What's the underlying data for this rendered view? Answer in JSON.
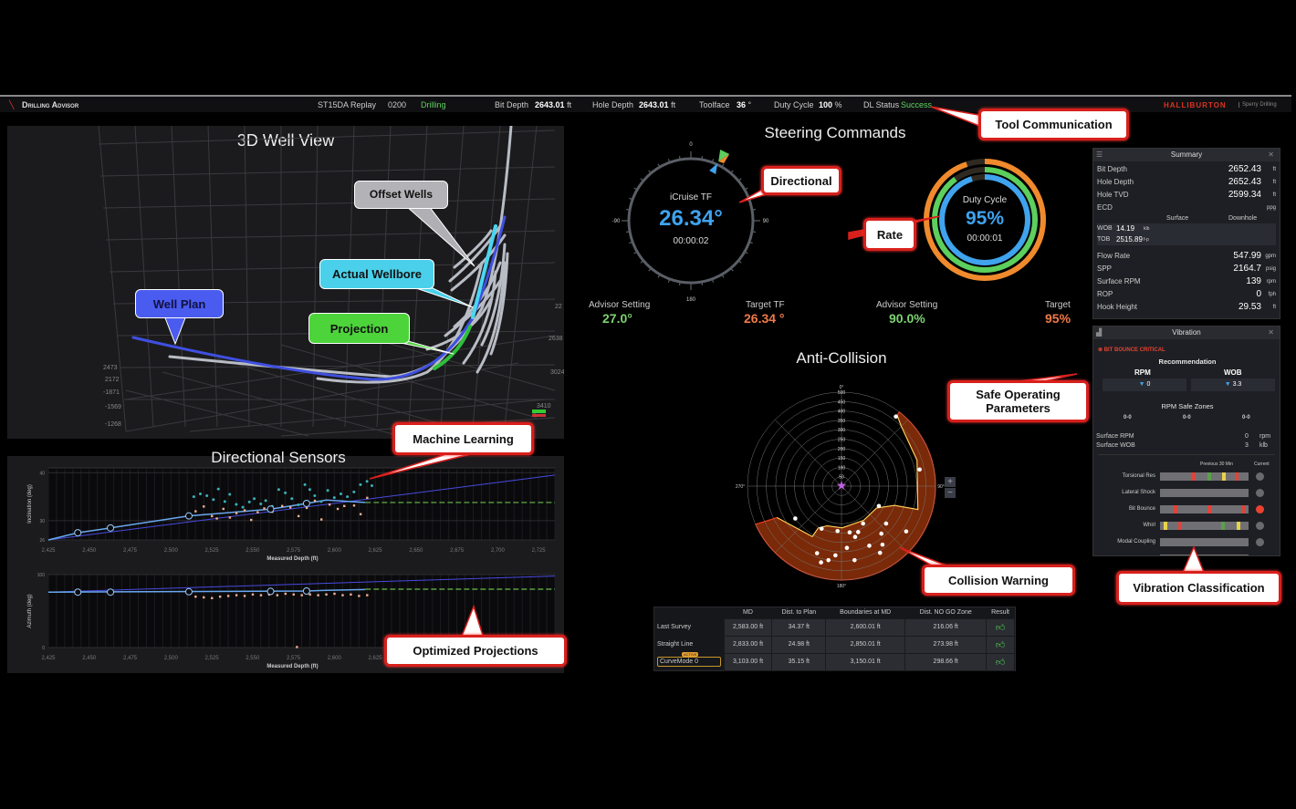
{
  "topbar": {
    "app_title": "Drilling Advisor",
    "well": "ST15DA Replay",
    "run": "0200",
    "state": "Drilling",
    "bit_depth_label": "Bit Depth",
    "bit_depth": "2643.01",
    "bit_depth_unit": "ft",
    "hole_depth_label": "Hole Depth",
    "hole_depth": "2643.01",
    "hole_depth_unit": "ft",
    "toolface_label": "Toolface",
    "toolface": "36",
    "toolface_unit": "°",
    "duty_label": "Duty Cycle",
    "duty": "100",
    "duty_unit": "%",
    "dl_label": "DL Status",
    "dl_status": "Success",
    "brand": "HALLIBURTON",
    "brand_sub": "Sperry Drilling"
  },
  "well_view": {
    "title": "3D Well View",
    "axis_labels": [
      "2473",
      "2172",
      "-1871",
      "-1569",
      "-1268",
      "22",
      "2638",
      "3024",
      "3410",
      "5"
    ]
  },
  "sensors": {
    "title": "Directional Sensors",
    "inclination": {
      "ylabel": "Inclination (deg)",
      "xlabel": "Measured Depth (ft)",
      "yticks": [
        26,
        30,
        40
      ],
      "xticks": [
        "2,425",
        "2,450",
        "2,475",
        "2,500",
        "2,525",
        "2,550",
        "2,575",
        "2,600",
        "2,625",
        "2,650",
        "2,675",
        "2,700",
        "2,725"
      ],
      "xlim": [
        2425,
        2735
      ],
      "ylim": [
        26,
        41
      ],
      "plan": [
        [
          2425,
          26
        ],
        [
          2735,
          39.5
        ]
      ],
      "surveys": [
        [
          2443,
          27.5
        ],
        [
          2463,
          28.5
        ],
        [
          2511,
          31
        ],
        [
          2561,
          32.4
        ],
        [
          2583,
          33.6
        ]
      ],
      "actual": [
        [
          2425,
          26
        ],
        [
          2443,
          27.5
        ],
        [
          2463,
          28.5
        ],
        [
          2511,
          31
        ],
        [
          2561,
          32.4
        ],
        [
          2583,
          33.6
        ],
        [
          2595,
          34.3
        ],
        [
          2619,
          33.8
        ]
      ],
      "projection": [
        [
          2619,
          33.8
        ],
        [
          2735,
          33.8
        ]
      ],
      "ml_points": [
        [
          2514,
          35
        ],
        [
          2518,
          35.6
        ],
        [
          2522,
          35.2
        ],
        [
          2526,
          34.4
        ],
        [
          2529,
          36.6
        ],
        [
          2533,
          34
        ],
        [
          2536,
          35.5
        ],
        [
          2540,
          33.4
        ],
        [
          2544,
          32.8
        ],
        [
          2548,
          33.9
        ],
        [
          2551,
          34.6
        ],
        [
          2555,
          33.5
        ],
        [
          2558,
          34.2
        ],
        [
          2562,
          33
        ],
        [
          2566,
          36.5
        ],
        [
          2570,
          35.8
        ],
        [
          2574,
          34.6
        ],
        [
          2578,
          33.3
        ],
        [
          2582,
          37.5
        ],
        [
          2585,
          36.5
        ],
        [
          2588,
          35.2
        ],
        [
          2592,
          34
        ],
        [
          2596,
          36.3
        ],
        [
          2600,
          34.8
        ],
        [
          2604,
          35.6
        ],
        [
          2608,
          35
        ],
        [
          2612,
          36
        ],
        [
          2616,
          37.5
        ],
        [
          2620,
          38.2
        ],
        [
          2623,
          37.3
        ]
      ],
      "raw_points": [
        [
          2515,
          32
        ],
        [
          2520,
          33
        ],
        [
          2525,
          31
        ],
        [
          2528,
          30.5
        ],
        [
          2532,
          32.5
        ],
        [
          2536,
          30.7
        ],
        [
          2540,
          31.6
        ],
        [
          2545,
          32.2
        ],
        [
          2549,
          30.2
        ],
        [
          2553,
          31.8
        ],
        [
          2557,
          32.6
        ],
        [
          2562,
          31.9
        ],
        [
          2568,
          33.1
        ],
        [
          2573,
          32.8
        ],
        [
          2578,
          31
        ],
        [
          2583,
          32.7
        ],
        [
          2588,
          34.2
        ],
        [
          2592,
          30.3
        ],
        [
          2597,
          33.4
        ],
        [
          2602,
          32.5
        ],
        [
          2606,
          33.1
        ],
        [
          2612,
          33.2
        ],
        [
          2616,
          31.4
        ],
        [
          2620,
          34.8
        ]
      ]
    },
    "azimuth": {
      "ylabel": "Azimuth (deg)",
      "xlabel": "Measured Depth (ft)",
      "yticks": [
        0,
        100
      ],
      "xticks": [
        "2,425",
        "2,450",
        "2,475",
        "2,500",
        "2,525",
        "2,550",
        "2,575",
        "2,600",
        "2,625"
      ],
      "xlim": [
        2425,
        2735
      ],
      "ylim": [
        0,
        100
      ],
      "plan": [
        [
          2425,
          76
        ],
        [
          2735,
          98
        ]
      ],
      "surveys": [
        [
          2443,
          76
        ],
        [
          2463,
          76
        ],
        [
          2511,
          76.5
        ],
        [
          2561,
          77
        ],
        [
          2583,
          77.5
        ]
      ],
      "actual": [
        [
          2425,
          76
        ],
        [
          2583,
          77.5
        ],
        [
          2595,
          78.5
        ],
        [
          2619,
          79.5
        ]
      ],
      "projection": [
        [
          2619,
          80
        ],
        [
          2735,
          80
        ]
      ],
      "raw_points": [
        [
          2515,
          70
        ],
        [
          2520,
          69
        ],
        [
          2525,
          68
        ],
        [
          2530,
          70
        ],
        [
          2535,
          71
        ],
        [
          2540,
          72
        ],
        [
          2545,
          71
        ],
        [
          2550,
          73
        ],
        [
          2555,
          72
        ],
        [
          2560,
          73
        ],
        [
          2565,
          72
        ],
        [
          2570,
          74
        ],
        [
          2575,
          73
        ],
        [
          2577,
          1
        ],
        [
          2580,
          72
        ],
        [
          2585,
          73
        ],
        [
          2590,
          72
        ],
        [
          2595,
          73
        ],
        [
          2600,
          74
        ],
        [
          2605,
          72
        ],
        [
          2610,
          73
        ],
        [
          2615,
          71
        ],
        [
          2620,
          72
        ]
      ]
    }
  },
  "steering": {
    "title": "Steering Commands",
    "tf": {
      "label": "iCruise TF",
      "value": "26.34°",
      "angle": 26.34,
      "timer": "00:00:02",
      "ticks": [
        "0",
        "90",
        "180",
        "-90"
      ]
    },
    "duty": {
      "label": "Duty Cycle",
      "value": "95%",
      "timer": "00:00:01",
      "rings": [
        {
          "color": "#f08a2c",
          "fraction": 0.95
        },
        {
          "color": "#5ccf5c",
          "fraction": 0.9
        },
        {
          "color": "#3fa3ee",
          "fraction": 0.95
        }
      ]
    },
    "readouts": [
      {
        "label": "Advisor Setting",
        "value": "27.0°",
        "color": "#7bd36f"
      },
      {
        "label": "Target TF",
        "value": "26.34 °",
        "color": "#f07a4a"
      },
      {
        "label": "Advisor Setting",
        "value": "90.0%",
        "color": "#7bd36f"
      },
      {
        "label": "Target",
        "value": "95%",
        "color": "#f07a4a"
      }
    ]
  },
  "anticollision": {
    "title": "Anti-Collision",
    "rings": [
      50,
      100,
      150,
      200,
      250,
      300,
      350,
      400,
      450,
      500
    ],
    "angle_labels": [
      "0°",
      "90°",
      "180°",
      "270°"
    ],
    "rmax": 500,
    "nogo_boundary": [
      [
        38,
        480
      ],
      [
        45,
        450
      ],
      [
        71,
        425
      ],
      [
        107,
        425
      ],
      [
        110,
        300
      ],
      [
        122,
        220
      ],
      [
        147,
        217
      ],
      [
        179,
        222
      ],
      [
        200,
        225
      ],
      [
        209,
        255
      ],
      [
        210,
        310
      ],
      [
        244,
        382
      ],
      [
        246,
        500
      ]
    ],
    "offset_points": [
      [
        38,
        470
      ],
      [
        78,
        425
      ],
      [
        118,
        225
      ],
      [
        150,
        230
      ],
      [
        160,
        260
      ],
      [
        170,
        250
      ],
      [
        165,
        280
      ],
      [
        175,
        330
      ],
      [
        185,
        240
      ],
      [
        185,
        370
      ],
      [
        190,
        400
      ],
      [
        195,
        420
      ],
      [
        200,
        380
      ],
      [
        155,
        350
      ],
      [
        145,
        380
      ],
      [
        140,
        330
      ],
      [
        130,
        310
      ],
      [
        125,
        420
      ],
      [
        150,
        410
      ],
      [
        170,
        400
      ],
      [
        205,
        250
      ],
      [
        235,
        300
      ]
    ],
    "zoom_in": "+",
    "zoom_out": "−",
    "table": {
      "headers": [
        "",
        "MD",
        "Dist. to Plan",
        "Boundaries at MD",
        "Dist. NO GO Zone",
        "Result"
      ],
      "rows": [
        {
          "name": "Last Survey",
          "md": "2,583.00 ft",
          "dist": "34.37 ft",
          "bound": "2,600.01 ft",
          "nogo": "216.06 ft"
        },
        {
          "name": "Straight Line",
          "md": "2,833.00 ft",
          "dist": "24.98 ft",
          "bound": "2,850.01 ft",
          "nogo": "273.98 ft"
        },
        {
          "name": "CurveMode 0",
          "md": "3,103.00 ft",
          "dist": "35.15 ft",
          "bound": "3,150.01 ft",
          "nogo": "298.66 ft",
          "badge": "ACTIVE"
        }
      ]
    }
  },
  "summary": {
    "title": "Summary",
    "top": [
      {
        "k": "Bit Depth",
        "v": "2652.43",
        "u": "ft"
      },
      {
        "k": "Hole Depth",
        "v": "2652.43",
        "u": "ft"
      },
      {
        "k": "Hole TVD",
        "v": "2599.34",
        "u": "ft"
      },
      {
        "k": "ECD",
        "v": "",
        "u": "ppg"
      }
    ],
    "surface_label": "Surface",
    "downhole_label": "Downhole",
    "mid": [
      {
        "k": "WOB",
        "v": "14.19",
        "u": "klb"
      },
      {
        "k": "TOB",
        "v": "2515.89",
        "u": "f-p"
      }
    ],
    "bottom": [
      {
        "k": "Flow Rate",
        "v": "547.99",
        "u": "gpm"
      },
      {
        "k": "SPP",
        "v": "2164.7",
        "u": "psig"
      },
      {
        "k": "Surface RPM",
        "v": "139",
        "u": "rpm"
      },
      {
        "k": "ROP",
        "v": "0",
        "u": "fph"
      },
      {
        "k": "Hook Height",
        "v": "29.53",
        "u": "ft"
      }
    ]
  },
  "vibration": {
    "title": "Vibration",
    "alert": "BIT BOUNCE CRITICAL",
    "recommendation": "Recommendation",
    "rpm_label": "RPM",
    "rpm": "0",
    "wob_label": "WOB",
    "wob": "3.3",
    "safe_zones": "RPM Safe Zones",
    "zones": [
      "0-0",
      "0-0",
      "0-0"
    ],
    "surf_rpm_label": "Surface RPM",
    "surf_rpm": "0",
    "surf_rpm_unit": "rpm",
    "surf_wob_label": "Surface WOB",
    "surf_wob": "3",
    "surf_wob_unit": "klb",
    "prev_label": "Previous 30 Min",
    "current_label": "Current",
    "rows": [
      {
        "name": "Torsional Res",
        "marks": [
          [
            0.38,
            "#e0443a"
          ],
          [
            0.56,
            "#5aa04a"
          ],
          [
            0.73,
            "#e8d24a"
          ],
          [
            0.88,
            "#e0443a"
          ]
        ],
        "current": "#6a6a6e"
      },
      {
        "name": "Lateral Shock",
        "marks": [],
        "current": "#6a6a6e"
      },
      {
        "name": "Bit Bounce",
        "marks": [
          [
            0.16,
            "#e0443a"
          ],
          [
            0.56,
            "#e0443a"
          ],
          [
            0.97,
            "#e0443a"
          ]
        ],
        "current": "#e8432f"
      },
      {
        "name": "Whirl",
        "marks": [
          [
            0.04,
            "#e8d24a"
          ],
          [
            0.22,
            "#e0443a"
          ],
          [
            0.72,
            "#5aa04a"
          ],
          [
            0.9,
            "#e8d24a"
          ]
        ],
        "current": "#6a6a6e"
      },
      {
        "name": "Modal Coupling",
        "marks": [],
        "current": "#6a6a6e"
      }
    ]
  },
  "callouts": {
    "tool_comm": "Tool Communication",
    "directional": "Directional",
    "rate": "Rate",
    "offset": "Offset Wells",
    "actual": "Actual Wellbore",
    "plan": "Well Plan",
    "projection": "Projection",
    "ml": "Machine Learning",
    "safe": "Safe Operating Parameters",
    "collision": "Collision Warning",
    "vib_class": "Vibration Classification",
    "optimized": "Optimized Projections"
  }
}
